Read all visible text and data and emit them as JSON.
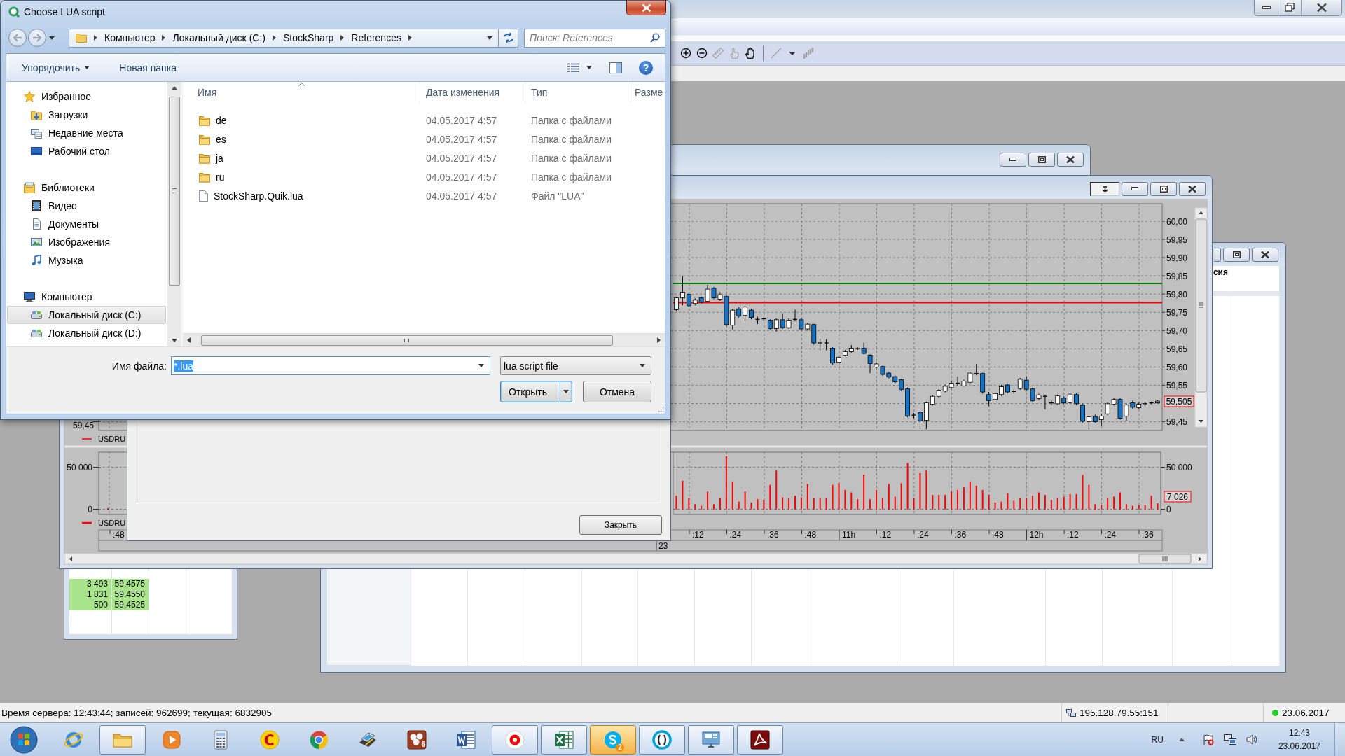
{
  "app_window": {
    "toolbar": [
      [
        {
          "kind": "zoom-in",
          "disabled": false
        },
        {
          "kind": "zoom-out",
          "disabled": false
        },
        {
          "kind": "ruler",
          "disabled": true
        },
        {
          "kind": "pointing-hand",
          "disabled": true
        },
        {
          "kind": "hand",
          "disabled": false
        }
      ],
      [
        {
          "kind": "line",
          "disabled": true
        },
        {
          "kind": "dropdown",
          "disabled": false
        },
        {
          "kind": "bars",
          "disabled": true
        }
      ]
    ]
  },
  "table_window": {
    "header": "сия"
  },
  "order_book": {
    "rows": [
      {
        "volume": "3 493",
        "price": "59,4575"
      },
      {
        "volume": "1 831",
        "price": "59,4550"
      },
      {
        "volume": "500",
        "price": "59,4525"
      }
    ]
  },
  "chart_window": {
    "anchored": true,
    "left_panel": {
      "price_tick": "59,45",
      "price_legend": "USDRU",
      "volume_ticks": [
        "50 000",
        "0"
      ],
      "volume_legend": "USDRU",
      "time_tick": ":48"
    },
    "price_ticks": [
      "60,00",
      "59,95",
      "59,90",
      "59,85",
      "59,80",
      "59,75",
      "59,70",
      "59,65",
      "59,60",
      "59,55",
      "59,45"
    ],
    "price_label": "59,505",
    "time_ticks": [
      ":12",
      ":24",
      ":36",
      ":48",
      "11h",
      ":12",
      ":24",
      ":36",
      ":48",
      "12h",
      ":12",
      ":24",
      ":36"
    ],
    "date_tick": "23",
    "volume": {
      "last_label": "7 026",
      "chart_data": {
        "type": "bar",
        "grid": true,
        "values": [
          16000,
          34000,
          13000,
          6000,
          4000,
          21000,
          6000,
          13000,
          63000,
          33000,
          9000,
          21000,
          8000,
          12000,
          11000,
          29000,
          46000,
          14000,
          13000,
          16000,
          14000,
          30000,
          13000,
          13000,
          13000,
          29000,
          31000,
          23000,
          20000,
          12000,
          41000,
          12000,
          23000,
          13000,
          30000,
          15000,
          31000,
          55000,
          13000,
          43000,
          46000,
          17000,
          17000,
          17000,
          21000,
          23000,
          26000,
          33000,
          28000,
          23000,
          17000,
          8000,
          9000,
          19000,
          10000,
          13000,
          13000,
          16000,
          20000,
          17000,
          11000,
          13000,
          15000,
          18000,
          18000,
          41000,
          29000,
          6000,
          5000,
          13000,
          15000,
          20000,
          6000,
          4000,
          5000,
          5000,
          16000,
          7026
        ],
        "ylim": [
          -6250,
          67900
        ],
        "yticks": [
          {
            "value": 0,
            "label": "0"
          },
          {
            "value": 50000,
            "label": "50 000"
          }
        ]
      }
    }
  },
  "message_window": {
    "button": "Закрыть"
  },
  "file_dialog": {
    "title": "Choose LUA script",
    "nav_buttons": [
      {
        "kind": "back",
        "disabled": true
      },
      {
        "kind": "forward",
        "disabled": true
      }
    ],
    "path": [
      "Компьютер",
      "Локальный диск (C:)",
      "StockSharp",
      "References"
    ],
    "search": {
      "placeholder": "Поиск: References"
    },
    "commands": [
      {
        "label": "Упорядочить",
        "kind": "menu"
      },
      {
        "label": "Новая папка",
        "kind": "button"
      }
    ],
    "help": "?",
    "nav": [
      {
        "label": "Избранное",
        "kind": "favorites",
        "selected": false,
        "children": [
          {
            "label": "Загрузки",
            "kind": "downloads",
            "selected": false
          },
          {
            "label": "Недавние места",
            "kind": "recent",
            "selected": false
          },
          {
            "label": "Рабочий стол",
            "kind": "desktop",
            "selected": false
          }
        ]
      },
      {
        "label": "Библиотеки",
        "kind": "libraries",
        "selected": false,
        "children": [
          {
            "label": "Видео",
            "kind": "video",
            "selected": false
          },
          {
            "label": "Документы",
            "kind": "documents",
            "selected": false
          },
          {
            "label": "Изображения",
            "kind": "pictures",
            "selected": false
          },
          {
            "label": "Музыка",
            "kind": "music",
            "selected": false
          }
        ]
      },
      {
        "label": "Компьютер",
        "kind": "computer",
        "selected": false,
        "children": [
          {
            "label": "Локальный диск (C:)",
            "kind": "drive",
            "selected": true
          },
          {
            "label": "Локальный диск (D:)",
            "kind": "drive",
            "selected": false
          }
        ]
      }
    ],
    "columns": [
      {
        "label": "Имя",
        "sorted": true
      },
      {
        "label": "Дата изменения",
        "sorted": false
      },
      {
        "label": "Тип",
        "sorted": false
      },
      {
        "label": "Разме",
        "sorted": false
      }
    ],
    "files": [
      {
        "kind": "folder",
        "name": "de",
        "modified": "04.05.2017 4:57",
        "type": "Папка с файлами",
        "selected": false
      },
      {
        "kind": "folder",
        "name": "es",
        "modified": "04.05.2017 4:57",
        "type": "Папка с файлами",
        "selected": false
      },
      {
        "kind": "folder",
        "name": "ja",
        "modified": "04.05.2017 4:57",
        "type": "Папка с файлами",
        "selected": false
      },
      {
        "kind": "folder",
        "name": "ru",
        "modified": "04.05.2017 4:57",
        "type": "Папка с файлами",
        "selected": false
      },
      {
        "kind": "file",
        "name": "StockSharp.Quik.lua",
        "modified": "04.05.2017 4:57",
        "type": "Файл \"LUA\"",
        "selected": false
      }
    ],
    "file_name": {
      "label": "Имя файла:",
      "value": "*.lua",
      "text_selected": true
    },
    "file_type": "lua script file",
    "buttons": [
      {
        "label": "Открыть",
        "kind": "split",
        "default": true
      },
      {
        "label": "Отмена",
        "kind": "plain",
        "default": false
      }
    ]
  },
  "status_bar": {
    "server_info": "Время сервера: 12:43:44; записей: 962699; текущая: 6832905",
    "connection": "195.128.79.55:151",
    "connected": true,
    "date": "23.06.2017"
  },
  "taskbar": {
    "apps": [
      {
        "kind": "internet-explorer",
        "running": false,
        "attention": false
      },
      {
        "kind": "explorer",
        "running": true,
        "attention": false
      },
      {
        "kind": "media-player",
        "running": false,
        "attention": false
      },
      {
        "kind": "calculator",
        "running": false,
        "attention": false
      },
      {
        "kind": "onec",
        "running": false,
        "attention": false
      },
      {
        "kind": "chrome",
        "running": false,
        "attention": false
      },
      {
        "kind": "scanner",
        "running": false,
        "attention": false
      },
      {
        "kind": "dots-app",
        "running": false,
        "attention": false,
        "badge": "6"
      },
      {
        "kind": "word",
        "running": false,
        "attention": false
      },
      {
        "kind": "yandex",
        "running": true,
        "attention": false
      },
      {
        "kind": "excel",
        "running": true,
        "attention": false
      },
      {
        "kind": "skype",
        "running": true,
        "attention": true,
        "badge": "2"
      },
      {
        "kind": "ring-app",
        "running": true,
        "attention": false
      },
      {
        "kind": "remote-app",
        "running": true,
        "attention": false
      },
      {
        "kind": "acrobat",
        "running": true,
        "attention": false
      }
    ],
    "language": "RU",
    "time": "12:43",
    "date": "23.06.2017"
  }
}
